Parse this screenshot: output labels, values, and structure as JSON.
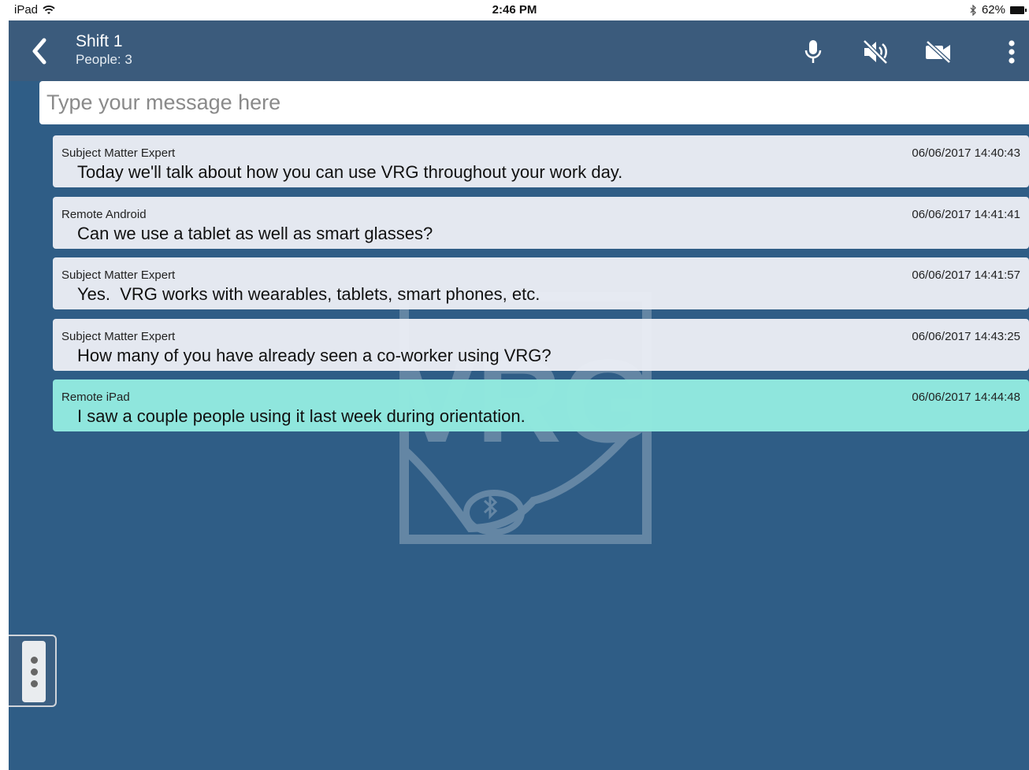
{
  "status_bar": {
    "device": "iPad",
    "time": "2:46 PM",
    "battery": "62%"
  },
  "header": {
    "title": "Shift 1",
    "subtitle": "People: 3"
  },
  "composer": {
    "placeholder": "Type your message here"
  },
  "messages": [
    {
      "sender": "Subject Matter Expert",
      "time": "06/06/2017 14:40:43",
      "text": "Today we'll talk about how you can use VRG throughout your work day."
    },
    {
      "sender": "Remote Android",
      "time": "06/06/2017 14:41:41",
      "text": "Can we use a tablet as well as smart glasses?"
    },
    {
      "sender": "Subject Matter Expert",
      "time": "06/06/2017 14:41:57",
      "text": "Yes.  VRG works with wearables, tablets, smart phones, etc."
    },
    {
      "sender": "Subject Matter Expert",
      "time": "06/06/2017 14:43:25",
      "text": "How many of you have already seen a co-worker using VRG?"
    },
    {
      "sender": "Remote iPad",
      "time": "06/06/2017 14:44:48",
      "text": "I saw a couple people using it last week during orientation."
    }
  ],
  "watermark": {
    "logo_text": "VRG"
  },
  "icons": {
    "back": "chevron-left-icon",
    "mic": "microphone-icon",
    "speaker": "speaker-muted-icon",
    "video": "video-off-icon",
    "more": "more-vertical-icon",
    "wifi": "wifi-icon",
    "bluetooth": "bluetooth-icon",
    "battery": "battery-icon",
    "handle": "more-vertical-icon"
  },
  "colors": {
    "app_background": "#2f5d86",
    "header_background": "#3b5b7c",
    "message_background": "#ebeef5",
    "highlight_message": "#91e9de"
  }
}
